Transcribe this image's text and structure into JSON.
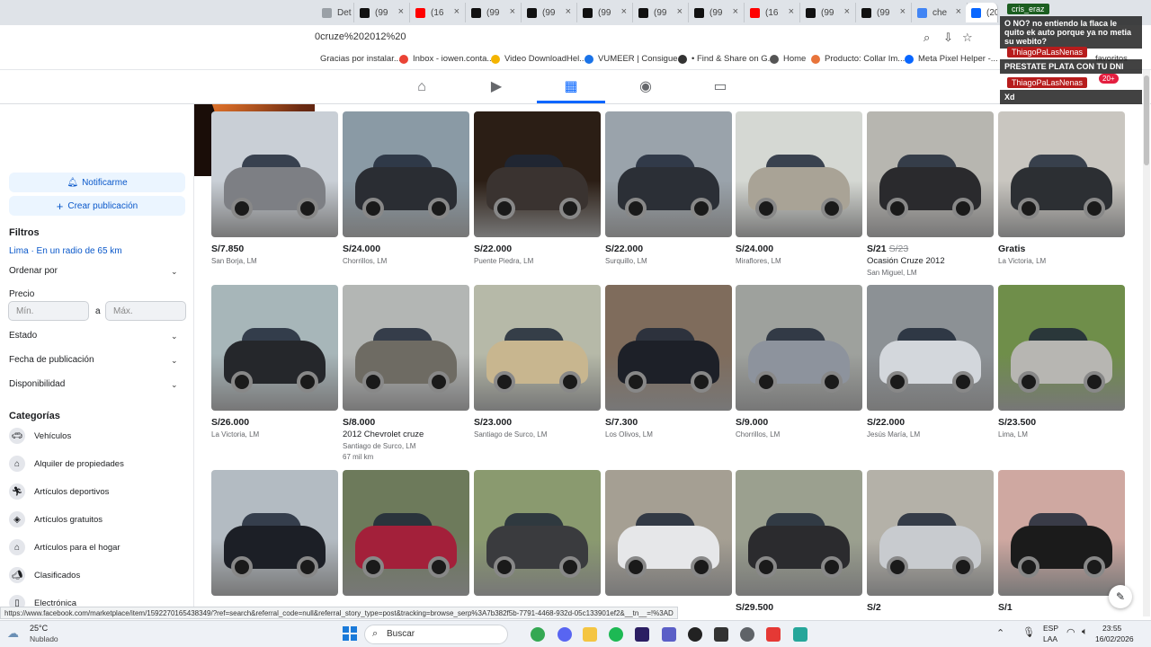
{
  "browser": {
    "tabs": [
      {
        "label": "Det",
        "icon": "tab-generic-icon",
        "color": "#9aa0a6"
      },
      {
        "label": "(99",
        "icon": "tiktok-icon",
        "color": "#111111"
      },
      {
        "label": "(16",
        "icon": "youtube-icon",
        "color": "#ff0000"
      },
      {
        "label": "(99",
        "icon": "tiktok-icon",
        "color": "#111111"
      },
      {
        "label": "(99",
        "icon": "tiktok-icon",
        "color": "#111111"
      },
      {
        "label": "(99",
        "icon": "tiktok-icon",
        "color": "#111111"
      },
      {
        "label": "(99",
        "icon": "tiktok-icon",
        "color": "#111111"
      },
      {
        "label": "(99",
        "icon": "tiktok-icon",
        "color": "#111111"
      },
      {
        "label": "(16",
        "icon": "youtube-icon",
        "color": "#ff0000"
      },
      {
        "label": "(99",
        "icon": "tiktok-icon",
        "color": "#111111"
      },
      {
        "label": "(99",
        "icon": "tiktok-icon",
        "color": "#111111"
      },
      {
        "label": "che",
        "icon": "google-icon",
        "color": "#4285f4"
      },
      {
        "label": "(20",
        "icon": "facebook-icon",
        "color": "#0866ff"
      }
    ],
    "url": "0cruze%202012%20",
    "bookmarks": [
      {
        "label": "Gracias por instalar...",
        "color": "#ffffff"
      },
      {
        "label": "Inbox - iowen.conta...",
        "color": "#ea4335"
      },
      {
        "label": "Video DownloadHel...",
        "color": "#f4b400"
      },
      {
        "label": "VUMEER | Consigue...",
        "color": "#1a73e8"
      },
      {
        "label": "• Find & Share on G...",
        "color": "#333333"
      },
      {
        "label": "Home",
        "color": "#555555"
      },
      {
        "label": "Producto: Collar Im...",
        "color": "#e8743b"
      },
      {
        "label": "Meta Pixel Helper -...",
        "color": "#0866ff"
      }
    ],
    "bookmarks_overflow": "favoritos",
    "status_url": "https://www.facebook.com/marketplace/item/1592270165438349/?ref=search&referral_code=null&referral_story_type=post&tracking=browse_serp%3A7b382f5b-7791-4468-932d-05c133901ef2&__tn__=!%3AD"
  },
  "sidebar": {
    "notify_label": "Notificarme",
    "create_label": "Crear publicación",
    "filters_title": "Filtros",
    "location": "Lima · En un radio de 65 km",
    "sort_label": "Ordenar por",
    "price_label": "Precio",
    "min_placeholder": "Mín.",
    "to_label": "a",
    "max_placeholder": "Máx.",
    "filters": [
      "Estado",
      "Fecha de publicación",
      "Disponibilidad"
    ],
    "categories_title": "Categorías",
    "categories": [
      {
        "label": "Vehículos",
        "icon": "car-icon"
      },
      {
        "label": "Alquiler de propiedades",
        "icon": "house-key-icon"
      },
      {
        "label": "Artículos deportivos",
        "icon": "running-icon"
      },
      {
        "label": "Artículos gratuitos",
        "icon": "tag-icon"
      },
      {
        "label": "Artículos para el hogar",
        "icon": "home-icon"
      },
      {
        "label": "Clasificados",
        "icon": "megaphone-icon"
      },
      {
        "label": "Electrónica",
        "icon": "phone-icon"
      }
    ]
  },
  "listings": [
    {
      "price": "S/7.850",
      "title": "",
      "location": "San Borja, LM",
      "km": "",
      "color": "#7d7f84",
      "bg": "#c9cfd6"
    },
    {
      "price": "S/24.000",
      "title": "",
      "location": "Chorrillos, LM",
      "km": "",
      "color": "#2a2d33",
      "bg": "#8a9aa5"
    },
    {
      "price": "S/22.000",
      "title": "",
      "location": "Puente Piedra, LM",
      "km": "",
      "color": "#3a3330",
      "bg": "#2b1e15"
    },
    {
      "price": "S/22.000",
      "title": "",
      "location": "Surquillo, LM",
      "km": "",
      "color": "#2b2f36",
      "bg": "#9aa3ab"
    },
    {
      "price": "S/24.000",
      "title": "",
      "location": "Miraflores, LM",
      "km": "",
      "color": "#a9a396",
      "bg": "#d5d8d3"
    },
    {
      "price": "S/21",
      "old_price": "S/23",
      "title": "Ocasión Cruze 2012",
      "location": "San Miguel, LM",
      "km": "",
      "color": "#2a2a2d",
      "bg": "#b7b6b0"
    },
    {
      "price": "Gratis",
      "title": "",
      "location": "La Victoria, LM",
      "km": "",
      "color": "#2c2f33",
      "bg": "#c9c6c0"
    },
    {
      "price": "S/26.000",
      "title": "",
      "location": "La Victoria, LM",
      "km": "",
      "color": "#25272b",
      "bg": "#a7b6b9"
    },
    {
      "price": "S/8.000",
      "title": "2012 Chevrolet cruze",
      "location": "Santiago de Surco, LM",
      "km": "67 mil km",
      "color": "#6e6b63",
      "bg": "#b3b6b4"
    },
    {
      "price": "S/23.000",
      "title": "",
      "location": "Santiago de Surco, LM",
      "km": "",
      "color": "#c8b68f",
      "bg": "#b6b9a8"
    },
    {
      "price": "S/7.300",
      "title": "",
      "location": "Los Olivos, LM",
      "km": "",
      "color": "#1d2028",
      "bg": "#7f6c5c"
    },
    {
      "price": "S/9.000",
      "title": "",
      "location": "Chorrillos, LM",
      "km": "",
      "color": "#8d939d",
      "bg": "#9ea19d"
    },
    {
      "price": "S/22.000",
      "title": "",
      "location": "Jesús María, LM",
      "km": "",
      "color": "#d3d7dc",
      "bg": "#8c9195"
    },
    {
      "price": "S/23.500",
      "title": "",
      "location": "Lima, LM",
      "km": "",
      "color": "#b7b6b2",
      "bg": "#6f8e4a"
    },
    {
      "price": "",
      "title": "",
      "location": "",
      "km": "",
      "color": "#1c1f26",
      "bg": "#b3bbc2"
    },
    {
      "price": "",
      "title": "",
      "location": "",
      "km": "",
      "color": "#a3203a",
      "bg": "#6d7a5b"
    },
    {
      "price": "",
      "title": "",
      "location": "",
      "km": "",
      "color": "#3a3b3e",
      "bg": "#8a9a6f"
    },
    {
      "price": "",
      "title": "",
      "location": "",
      "km": "",
      "color": "#e6e7e9",
      "bg": "#a59f93"
    },
    {
      "price": "S/29.500",
      "title": "",
      "location": "",
      "km": "",
      "color": "#2b2b2e",
      "bg": "#9ba08f"
    },
    {
      "price": "S/2",
      "title": "",
      "location": "",
      "km": "",
      "color": "#c8cbcf",
      "bg": "#b4b1a8"
    },
    {
      "price": "S/1",
      "title": "",
      "location": "",
      "km": "",
      "color": "#1b1b1b",
      "bg": "#cfa8a1"
    }
  ],
  "chat": {
    "messages": [
      {
        "user": "cris_eraz",
        "text": "O NO? no entiendo la flaca le quito ek auto porque ya no metia su webito?"
      },
      {
        "user": "ThiagoPaLasNenas",
        "text": "PRESTATE PLATA CON TU DNI"
      },
      {
        "user": "ThiagoPaLasNenas",
        "text": "Xd"
      }
    ],
    "notif_badge": "20+"
  },
  "taskbar": {
    "weather_temp": "25°C",
    "weather_desc": "Nublado",
    "search_placeholder": "Buscar",
    "lang": "ESP",
    "lang_sub": "LAA",
    "time": "23:55",
    "date": "16/02/2026"
  }
}
